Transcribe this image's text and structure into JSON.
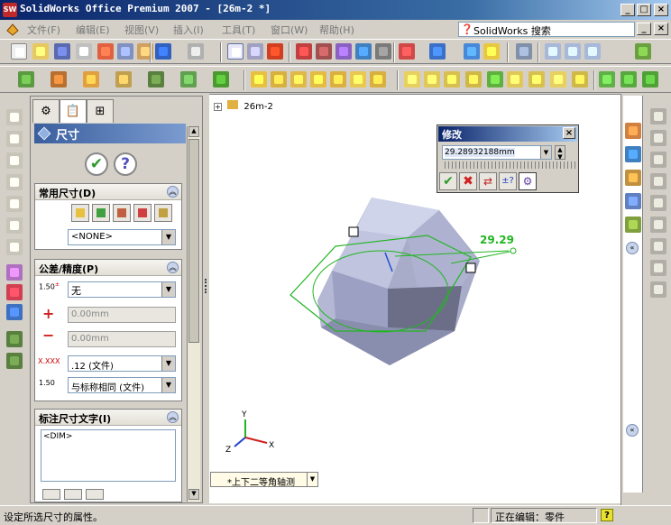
{
  "window": {
    "title": "SolidWorks Office Premium 2007 - [26m-2 *]",
    "app_icon": "SW",
    "minimize": "_",
    "maximize": "□",
    "close": "×",
    "doc_minimize": "_",
    "doc_restore": "□",
    "doc_close": "×"
  },
  "menu": {
    "items": [
      "文件(F)",
      "编辑(E)",
      "视图(V)",
      "插入(I)",
      "工具(T)",
      "窗口(W)",
      "帮助(H)"
    ],
    "search_label": "SolidWorks 搜索"
  },
  "property_manager": {
    "title": "尺寸",
    "ok": "✔",
    "help": "?",
    "groups": {
      "favorite": {
        "title": "常用尺寸(D)",
        "dropdown_value": "<NONE>"
      },
      "tolerance": {
        "title": "公差/精度(P)",
        "tol_type": "无",
        "upper": "0.00mm",
        "lower": "0.00mm",
        "precision": ".12 (文件)",
        "tol_precision": "与标称相同 (文件)",
        "icon_tol_a": "1.50",
        "icon_tol_b": "+.01\n-.01",
        "icon_prec": "X.XXX",
        "icon_prec_b": "1.50",
        "icon_prec_c": "+.XX\n-.XX"
      },
      "dim_text": {
        "title": "标注尺寸文字(I)",
        "text": "<DIM>"
      }
    }
  },
  "tree": {
    "root_expander": "+",
    "root_name": "26m-2"
  },
  "modify_dialog": {
    "title": "修改",
    "value": "29.28932188mm",
    "buttons": [
      "✔",
      "✖",
      "⇄",
      "±?",
      "⚙"
    ]
  },
  "model": {
    "dimension_label": "29.29",
    "axes": {
      "x": "X",
      "y": "Y",
      "z": "Z"
    }
  },
  "view": {
    "current": "*上下二等角轴测"
  },
  "statusbar": {
    "hint": "设定所选尺寸的属性。",
    "mode": "正在编辑：零件",
    "help": "?"
  },
  "colors": {
    "sketch_green": "#22b522",
    "body_face": "#b8bcd8",
    "body_dark": "#6a6c86",
    "title_blue": "#0a246a"
  }
}
